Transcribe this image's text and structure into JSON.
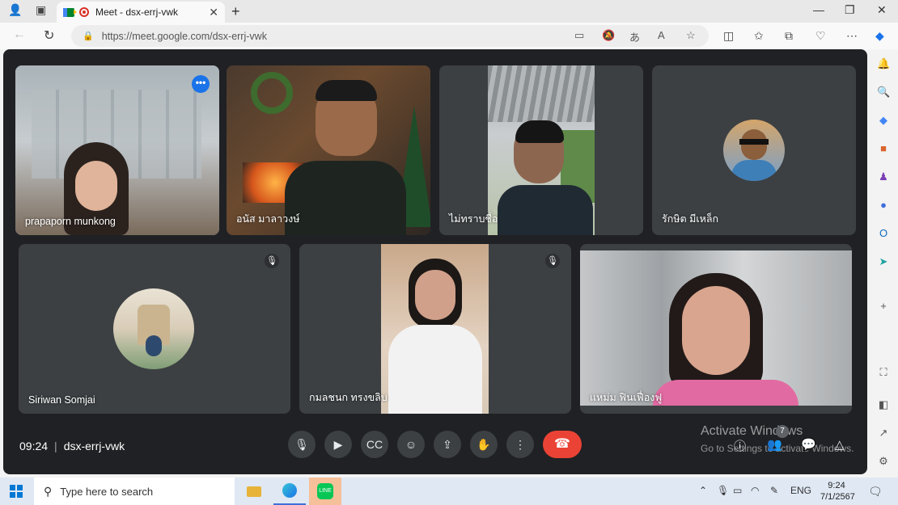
{
  "browser": {
    "tab_title": "Meet - dsx-errj-vwk",
    "tab_close": "✕",
    "new_tab": "+",
    "url": "https://meet.google.com/dsx-errj-vwk"
  },
  "tiles": [
    {
      "name": "prapaporn munkong"
    },
    {
      "name": "อนัส มาลาวงษ์"
    },
    {
      "name": "ไม่ทราบชื่อ"
    },
    {
      "name": "รักษิต มีเหล็ก"
    },
    {
      "name": "Siriwan Somjai"
    },
    {
      "name": "กมลชนก ทรงขลิบ"
    },
    {
      "name": "แหม่ม ฟินเฟื่องฟู"
    }
  ],
  "tile_menu": "•••",
  "controls": {
    "time": "09:24",
    "meeting_code": "dsx-errj-vwk",
    "people_count": "7"
  },
  "watermark": {
    "line1": "Activate Windows",
    "line2": "Go to Settings to activate Windows."
  },
  "taskbar": {
    "search_placeholder": "Type here to search",
    "lang": "ENG",
    "time": "9:24",
    "date": "7/1/2567"
  }
}
